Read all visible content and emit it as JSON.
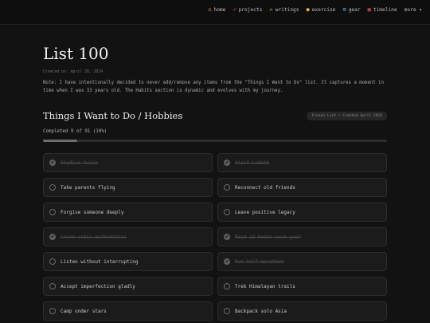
{
  "nav": [
    {
      "icon": "home-icon",
      "glyph": "⌂",
      "cls": "home",
      "label": "home"
    },
    {
      "icon": "rocket-icon",
      "glyph": "➶",
      "cls": "rocket",
      "label": "projects"
    },
    {
      "icon": "pen-icon",
      "glyph": "✍",
      "cls": "pen",
      "label": "writings"
    },
    {
      "icon": "flexed-arm-icon",
      "glyph": "●",
      "cls": "arm",
      "label": "exercise"
    },
    {
      "icon": "gear-icon",
      "glyph": "⚙",
      "cls": "gear",
      "label": "gear"
    },
    {
      "icon": "calendar-icon",
      "glyph": "▦",
      "cls": "cal",
      "label": "timeline"
    }
  ],
  "nav_more": "more ▾",
  "page": {
    "title": "List 100",
    "created": "Created on: April 20, 2024",
    "note": "Note: I have intentionally decided to never add/remove any items from the \"Things I Want to Do\" list. It captures a moment in time when I was 33 years old. The Habits section is dynamic and evolves with my journey."
  },
  "section": {
    "title": "Things I Want to Do / Hobbies",
    "badge": "Frozen List • Created April 2024",
    "completed": "Completed 9 of 91 (10%)",
    "progress_percent": 10
  },
  "items": [
    {
      "label": "Skydive twice",
      "done": true
    },
    {
      "label": "Visit Ladakh",
      "done": true
    },
    {
      "label": "Take parents flying",
      "done": false
    },
    {
      "label": "Reconnect old friends",
      "done": false
    },
    {
      "label": "Forgive someone deeply",
      "done": false
    },
    {
      "label": "Leave positive legacy",
      "done": false
    },
    {
      "label": "Learn vedic mathematics",
      "done": true
    },
    {
      "label": "Read 12 books each year",
      "done": true
    },
    {
      "label": "Listen without interrupting",
      "done": false
    },
    {
      "label": "Run half marathon",
      "done": true
    },
    {
      "label": "Accept imperfection gladly",
      "done": false
    },
    {
      "label": "Trek Himalayan trails",
      "done": false
    },
    {
      "label": "Camp under stars",
      "done": false
    },
    {
      "label": "Backpack solo Asia",
      "done": false
    }
  ]
}
